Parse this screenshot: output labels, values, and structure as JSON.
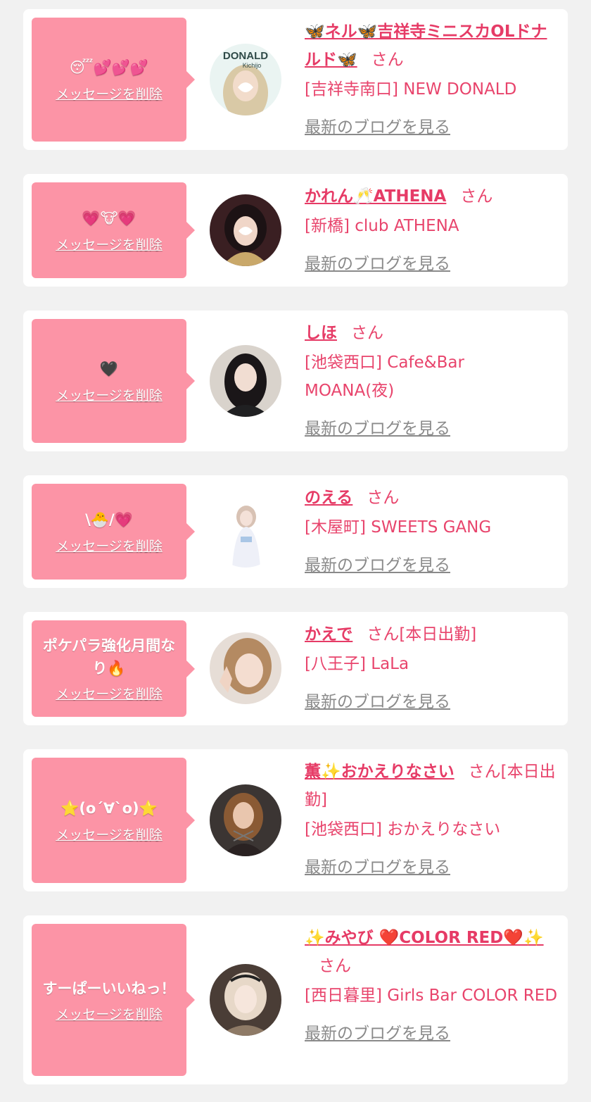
{
  "cards": [
    {
      "message": "😴💕💕💕",
      "delete_label": "メッセージを削除",
      "name": "🦋ネル🦋吉祥寺ミニスカOLドナルド🦋",
      "suffix": "さん",
      "shop": "[吉祥寺南口] NEW DONALD",
      "blog_label": "最新のブログを見る",
      "avatar_text": "DONALD Kichijo"
    },
    {
      "message": "💗🐮💗",
      "delete_label": "メッセージを削除",
      "name": "かれん🥂ATHENA",
      "suffix": "さん",
      "shop": "[新橋] club ATHENA",
      "blog_label": "最新のブログを見る"
    },
    {
      "message": "🖤",
      "delete_label": "メッセージを削除",
      "name": "しほ",
      "suffix": "さん",
      "shop": "[池袋西口] Cafe&Bar MOANA(夜)",
      "blog_label": "最新のブログを見る"
    },
    {
      "message": "\\🐣/💗",
      "delete_label": "メッセージを削除",
      "name": "のえる",
      "suffix": "さん",
      "shop": "[木屋町] SWEETS GANG",
      "blog_label": "最新のブログを見る"
    },
    {
      "message": "ポケパラ強化月間なり🔥",
      "delete_label": "メッセージを削除",
      "name": "かえで",
      "suffix": "さん[本日出勤]",
      "shop": "[八王子] LaLa",
      "blog_label": "最新のブログを見る"
    },
    {
      "message": "⭐(o´∀`o)⭐",
      "delete_label": "メッセージを削除",
      "name": "薫✨おかえりなさい",
      "suffix": "さん[本日出勤]",
      "shop": "[池袋西口] おかえりなさい",
      "blog_label": "最新のブログを見る"
    },
    {
      "message": "すーぱーいいねっ！",
      "delete_label": "メッセージを削除",
      "name": "✨みやび ❤️COLOR RED❤️✨",
      "suffix": "さん",
      "shop": "[西日暮里] Girls Bar COLOR RED",
      "blog_label": "最新のブログを見る"
    }
  ],
  "colors": {
    "page_bg": "#f1f1f1",
    "bubble": "#fc94a6",
    "accent": "#e8446c",
    "link_gray": "#8a8a8a"
  }
}
